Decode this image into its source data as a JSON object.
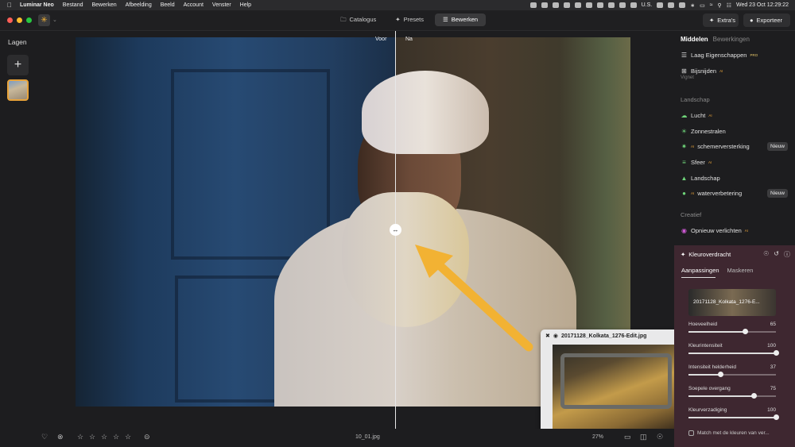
{
  "menubar": {
    "app_name": "Luminar Neo",
    "items": [
      "Bestand",
      "Bewerken",
      "Afbeelding",
      "Beeld",
      "Account",
      "Venster",
      "Help"
    ],
    "input_source": "U.S.",
    "datetime": "Wed 23 Oct  12:29:22"
  },
  "toolbar": {
    "tabs": [
      {
        "label": "Catalogus",
        "icon": "folder-icon"
      },
      {
        "label": "Presets",
        "icon": "presets-icon"
      },
      {
        "label": "Bewerken",
        "icon": "edit-sliders-icon"
      }
    ],
    "active_tab": "Bewerken",
    "extras_label": "Extra's",
    "export_label": "Exporteer"
  },
  "left_panel": {
    "title": "Lagen",
    "add_symbol": "+"
  },
  "canvas": {
    "before_label": "Voor",
    "after_label": "Na",
    "compare_split_fraction": 0.575
  },
  "popup": {
    "filename": "20171128_Kolkata_1276-Edit.jpg"
  },
  "bottom_bar": {
    "filename": "10_01.jpg",
    "zoom": "27%",
    "star_count": 5
  },
  "right_panel": {
    "tab_active": "Middelen",
    "tab_inactive": "Bewerkingen",
    "tools_top": [
      {
        "label": "Laag Eigenschappen",
        "icon": "layers-icon",
        "tag": "PRO"
      },
      {
        "label": "Bijsnijden",
        "icon": "crop-icon",
        "tag": "AI"
      }
    ],
    "partial_item": "Vignet",
    "section_landschap": "Landschap",
    "landschap_items": [
      {
        "label": "Lucht",
        "icon": "cloud-icon",
        "tag": "AI",
        "new": false
      },
      {
        "label": "Zonnestralen",
        "icon": "sunrays-icon",
        "tag": "",
        "new": false
      },
      {
        "label": "schemerversterking",
        "icon": "twilight-icon",
        "tag": "AI",
        "new": true
      },
      {
        "label": "Sfeer",
        "icon": "atmosphere-icon",
        "tag": "AI",
        "new": false
      },
      {
        "label": "Landschap",
        "icon": "landscape-icon",
        "tag": "",
        "new": false
      },
      {
        "label": "waterverbetering",
        "icon": "water-drop-icon",
        "tag": "AI",
        "new": true
      }
    ],
    "new_badge": "Nieuw",
    "section_creatief": "Creatief",
    "creatief_items": [
      {
        "label": "Opnieuw verlichten",
        "icon": "relight-icon",
        "tag": "AI"
      }
    ]
  },
  "color_transfer": {
    "title": "Kleuroverdracht",
    "tab_adjust": "Aanpassingen",
    "tab_masks": "Maskeren",
    "reference_name": "20171128_Kolkata_1276-E...",
    "sliders": [
      {
        "label": "Hoeveelheid",
        "value": 65,
        "max": 100
      },
      {
        "label": "Kleurintensiteit",
        "value": 100,
        "max": 100
      },
      {
        "label": "Intensiteit helderheid",
        "value": 37,
        "max": 100
      },
      {
        "label": "Soepele overgang",
        "value": 75,
        "max": 100
      },
      {
        "label": "Kleurverzadiging",
        "value": 100,
        "max": 100
      }
    ],
    "match_label": "Match met de kleuren van ver..."
  },
  "colors": {
    "accent": "#f5b335",
    "panel_highlight": "#3e2730",
    "arrow": "#f2b233"
  }
}
